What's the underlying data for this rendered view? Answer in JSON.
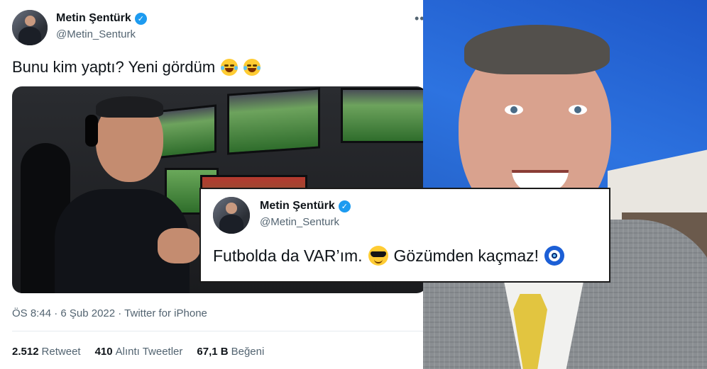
{
  "main_tweet": {
    "display_name": "Metin Şentürk",
    "handle": "@Metin_Senturk",
    "more_icon": "more-horizontal-icon",
    "text": "Bunu kim yaptı? Yeni gördüm",
    "emojis": [
      "face-with-tears-of-joy",
      "face-with-tears-of-joy"
    ],
    "timestamp": "ÖS 8:44 · 6 Şub 2022 · Twitter for iPhone",
    "stats": [
      {
        "count": "2.512",
        "label": "Retweet"
      },
      {
        "count": "410",
        "label": "Alıntı Tweetler"
      },
      {
        "count": "67,1 B",
        "label": "Beğeni"
      }
    ]
  },
  "embedded_tweet": {
    "display_name": "Metin Şentürk",
    "handle": "@Metin_Senturk",
    "text_part1": "Futbolda da VAR’ım.",
    "text_part2": "Gözümden kaçmaz!",
    "emojis": [
      "smiling-face-with-sunglasses",
      "nazar-amulet"
    ]
  },
  "colors": {
    "verified": "#1d9bf0",
    "secondary_text": "#536471",
    "primary_text": "#0f1419"
  }
}
